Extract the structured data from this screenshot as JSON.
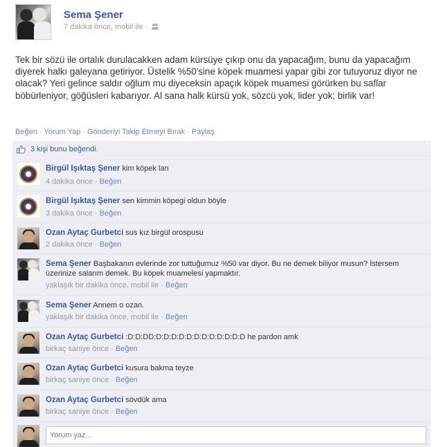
{
  "post": {
    "author": "Sema Şener",
    "meta": "7 dakika önce, mobil ile ·",
    "text": "Tek bir sözü ile ortalık durulacakken adam kürsüye çıkıp onu da yapacağım, bunu da yapacağım diyerek halkı galeyana getiriyor. Üstelik %50'sine köpek muamesi yapar gibi zor tutuyoruz diyor ne olacak? Yeri gelince saldır oğlum mu diyeceksin apaçık köpek muamesi görürken bu saflar böbürleniyor, göğüsleri kabarıyor. Al sana halk kürsü yok, sözcü yok, lider yok; birlik var!"
  },
  "actions": {
    "like": "Beğen",
    "comment": "Yorum Yap",
    "unfollow": "Gönderiyi Takip Etmeyi Bırak",
    "share": "Paylaş",
    "separator": "·"
  },
  "likes": {
    "text": "3 kişi bunu beğendi.",
    "icon": "thumbs-up-icon"
  },
  "comments": [
    {
      "author": "Birgül Işıktaş Şener",
      "text": "kim köpek lan",
      "time": "4 dakika önce ·",
      "like": "Beğen",
      "avatar": "badge"
    },
    {
      "author": "Birgül Işıktaş Şener",
      "text": "sen kimmin köpegi oldun böyle",
      "time": "3 dakika önce ·",
      "like": "Beğen",
      "avatar": "badge"
    },
    {
      "author": "Ozan Aytaç Gurbetci",
      "text": "sus kız birgül orospusu",
      "time": "2 dakika önce ·",
      "like": "Beğen",
      "avatar": "ozan"
    },
    {
      "author": "Sema Şener",
      "text": "Başbakanın evlerinde zor tuttuğumuz %50 var diyor. Bu ne demek biliyor musun? İstersem üzerinize salarım demek. Bu köpek muamelesi yapmaktır.",
      "time": "yaklaşık bir dakika önce, mobil ile ·",
      "like": "Beğen",
      "avatar": "sema"
    },
    {
      "author": "Sema Şener",
      "text": "Annem o ozan.",
      "time": "yaklaşık bir dakika önce, mobil ile ·",
      "like": "Beğen",
      "avatar": "sema"
    },
    {
      "author": "Ozan Aytaç Gurbetci",
      "text": ":D:D:DD:D:D:D:D:D:D:D:D:D:D:D:D he pardon amk",
      "time": "birkaç saniye önce ·",
      "like": "Beğen",
      "avatar": "ozan"
    },
    {
      "author": "Ozan Aytaç Gurbetci",
      "text": "kusura bakma teyze",
      "time": "birkaç saniye önce ·",
      "like": "Beğen",
      "avatar": "ozan"
    },
    {
      "author": "Ozan Aytaç Gurbetci",
      "text": "sövdük ama",
      "time": "birkaç saniye önce ·",
      "like": "Beğen",
      "avatar": "ozan"
    }
  ],
  "comment_box": {
    "placeholder": "Yorum yaz..."
  },
  "colors": {
    "link": "#3b5998",
    "ufi_background": "#edeff4",
    "meta_text": "#999999"
  }
}
